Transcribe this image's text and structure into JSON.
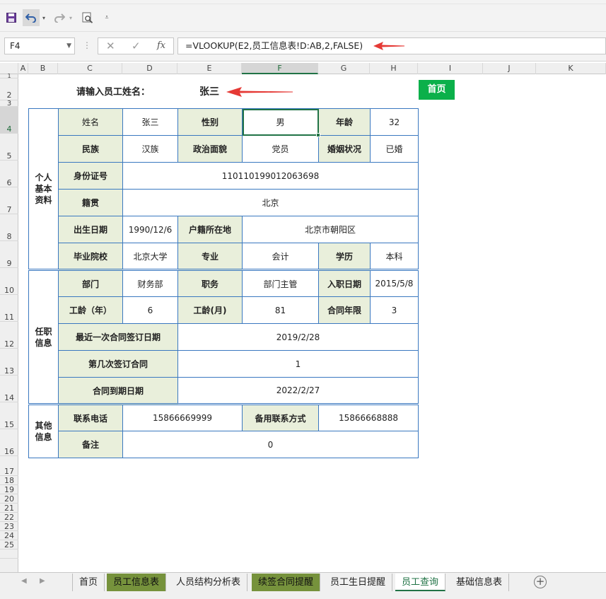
{
  "toolbar": {
    "save_icon": "save-icon",
    "undo_icon": "undo-icon",
    "redo_icon": "redo-icon",
    "preview_icon": "print-preview-icon",
    "customize_icon": "customize-quick-access-icon"
  },
  "formula_bar": {
    "name_box": "F4",
    "cancel_glyph": "✕",
    "enter_glyph": "✓",
    "fx_glyph": "fx",
    "formula": "=VLOOKUP(E2,员工信息表!D:AB,2,FALSE)"
  },
  "columns": [
    "A",
    "B",
    "C",
    "D",
    "E",
    "F",
    "G",
    "H",
    "I",
    "J",
    "K"
  ],
  "rows": [
    "1",
    "2",
    "3",
    "4",
    "5",
    "6",
    "7",
    "8",
    "9",
    "10",
    "11",
    "12",
    "13",
    "14",
    "15",
    "16",
    "17",
    "18",
    "19",
    "20",
    "21",
    "22",
    "23",
    "24",
    "25"
  ],
  "sheet": {
    "prompt_label": "请输入员工姓名：",
    "name_value": "张三",
    "home_button": "首页"
  },
  "sections": {
    "personal": "个人\n基本\n资料",
    "job": "任职\n信息",
    "other": "其他\n信息"
  },
  "fields": {
    "name_label": "姓名",
    "name_value": "张三",
    "gender_label": "性别",
    "gender_value": "男",
    "age_label": "年龄",
    "age_value": "32",
    "ethnicity_label": "民族",
    "ethnicity_value": "汉族",
    "political_label": "政治面貌",
    "political_value": "党员",
    "marital_label": "婚姻状况",
    "marital_value": "已婚",
    "id_label": "身份证号",
    "id_value": "110110199012063698",
    "native_label": "籍贯",
    "native_value": "北京",
    "birth_label": "出生日期",
    "birth_value": "1990/12/6",
    "hukou_label": "户籍所在地",
    "hukou_value": "北京市朝阳区",
    "school_label": "毕业院校",
    "school_value": "北京大学",
    "major_label": "专业",
    "major_value": "会计",
    "edu_label": "学历",
    "edu_value": "本科",
    "dept_label": "部门",
    "dept_value": "财务部",
    "position_label": "职务",
    "position_value": "部门主管",
    "join_label": "入职日期",
    "join_value": "2015/5/8",
    "years_label": "工龄（年）",
    "years_value": "6",
    "months_label": "工龄(月)",
    "months_value": "81",
    "term_label": "合同年限",
    "term_value": "3",
    "last_sign_label": "最近一次合同签订日期",
    "last_sign_value": "2019/2/28",
    "sign_count_label": "第几次签订合同",
    "sign_count_value": "1",
    "expiry_label": "合同到期日期",
    "expiry_value": "2022/2/27",
    "phone_label": "联系电话",
    "phone_value": "15866669999",
    "alt_contact_label": "备用联系方式",
    "alt_contact_value": "15866668888",
    "remark_label": "备注",
    "remark_value": "0"
  },
  "tabs": {
    "home": "首页",
    "employee_info": "员工信息表",
    "structure": "人员结构分析表",
    "renewal": "续签合同提醒",
    "birthday": "员工生日提醒",
    "query": "员工查询",
    "base_info": "基础信息表",
    "add_sheet": "+",
    "active": "员工查询"
  },
  "colors": {
    "accent": "#217346",
    "home_button": "#0bb04a",
    "label_fill": "#e9efdb",
    "border": "#3a78c0",
    "tab_green": "#76923c",
    "arrow": "#e53935"
  }
}
